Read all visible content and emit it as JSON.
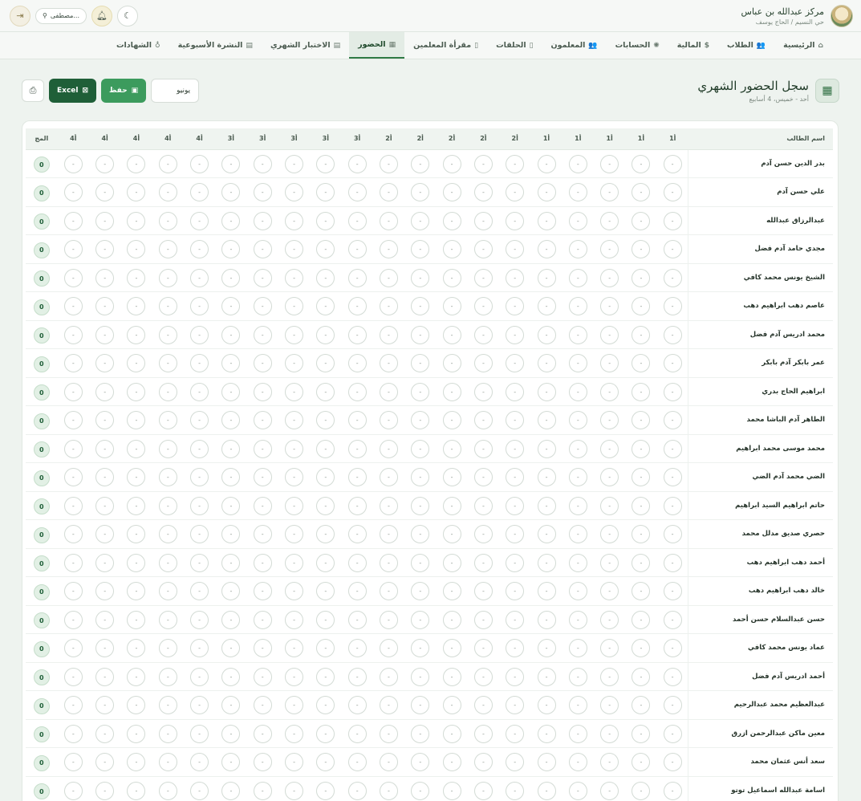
{
  "header": {
    "brand_name": "مركز عبدالله بن عباس",
    "brand_sub": "حي النسيم / الحاج يوسف",
    "user_label": "مصطفى...",
    "icons": {
      "logout": "logout-icon",
      "user": "user-icon",
      "bell": "bell-icon",
      "theme": "moon-icon"
    }
  },
  "nav": {
    "items": [
      {
        "label": "الرئيسية",
        "icon": "home-icon",
        "glyph": "⌂"
      },
      {
        "label": "الطلاب",
        "icon": "users-icon",
        "glyph": "👥"
      },
      {
        "label": "المالية",
        "icon": "dollar-icon",
        "glyph": "$"
      },
      {
        "label": "الحسابات",
        "icon": "gear-icon",
        "glyph": "✺"
      },
      {
        "label": "المعلمون",
        "icon": "teachers-icon",
        "glyph": "👥"
      },
      {
        "label": "الحلقات",
        "icon": "book-icon",
        "glyph": "▯"
      },
      {
        "label": "مقرأة المعلمين",
        "icon": "book-icon",
        "glyph": "▯"
      },
      {
        "label": "الحضور",
        "icon": "calendar-check-icon",
        "glyph": "▦",
        "active": true
      },
      {
        "label": "الاختبار الشهري",
        "icon": "document-icon",
        "glyph": "▤"
      },
      {
        "label": "النشرة الأسبوعية",
        "icon": "newspaper-icon",
        "glyph": "▤"
      },
      {
        "label": "الشهادات",
        "icon": "award-icon",
        "glyph": "♁"
      }
    ]
  },
  "page": {
    "title": "سجل الحضور الشهري",
    "subtitle": "أحد - خميس، 4 أسابيع",
    "month": "يونيو",
    "save_label": "حفظ",
    "excel_label": "Excel"
  },
  "table": {
    "name_header": "اسم الطالب",
    "day_headers": [
      "أ1",
      "أ1",
      "أ1",
      "أ1",
      "أ1",
      "أ2",
      "أ2",
      "أ2",
      "أ2",
      "أ2",
      "أ3",
      "أ3",
      "أ3",
      "أ3",
      "أ3",
      "أ4",
      "أ4",
      "أ4",
      "أ4",
      "أ4"
    ],
    "total_header": "المج",
    "empty_mark": "-",
    "rows": [
      {
        "name": "بدر الدين حسن آدم",
        "total": "0"
      },
      {
        "name": "علي حسن آدم",
        "total": "0"
      },
      {
        "name": "عبدالرزاق عبدالله",
        "total": "0"
      },
      {
        "name": "مجدي حامد آدم فضل",
        "total": "0"
      },
      {
        "name": "الشيخ يونس محمد كافي",
        "total": "0"
      },
      {
        "name": "عاصم دهب ابراهيم دهب",
        "total": "0"
      },
      {
        "name": "محمد ادريس آدم فضل",
        "total": "0"
      },
      {
        "name": "عمر بابكر آدم بابكر",
        "total": "0"
      },
      {
        "name": "ابراهيم الحاج بدري",
        "total": "0"
      },
      {
        "name": "الطاهر آدم الباشا محمد",
        "total": "0"
      },
      {
        "name": "محمد موسى محمد ابراهيم",
        "total": "0"
      },
      {
        "name": "الضي محمد آدم الضي",
        "total": "0"
      },
      {
        "name": "حاتم ابراهيم السيد ابراهيم",
        "total": "0"
      },
      {
        "name": "حصري صديق مدلل محمد",
        "total": "0"
      },
      {
        "name": "أحمد دهب ابراهيم دهب",
        "total": "0"
      },
      {
        "name": "خالد دهب ابراهيم دهب",
        "total": "0"
      },
      {
        "name": "حسن عبدالسلام حسن أحمد",
        "total": "0"
      },
      {
        "name": "عماد يونس محمد كافي",
        "total": "0"
      },
      {
        "name": "أحمد ادريس آدم فضل",
        "total": "0"
      },
      {
        "name": "عبدالعظيم محمد عبدالرحيم",
        "total": "0"
      },
      {
        "name": "معين ماكن عبدالرحمن ازرق",
        "total": "0"
      },
      {
        "name": "سعد أنس عثمان محمد",
        "total": "0"
      },
      {
        "name": "اسامة عبدالله اسماعيل توتو",
        "total": "0"
      }
    ]
  }
}
